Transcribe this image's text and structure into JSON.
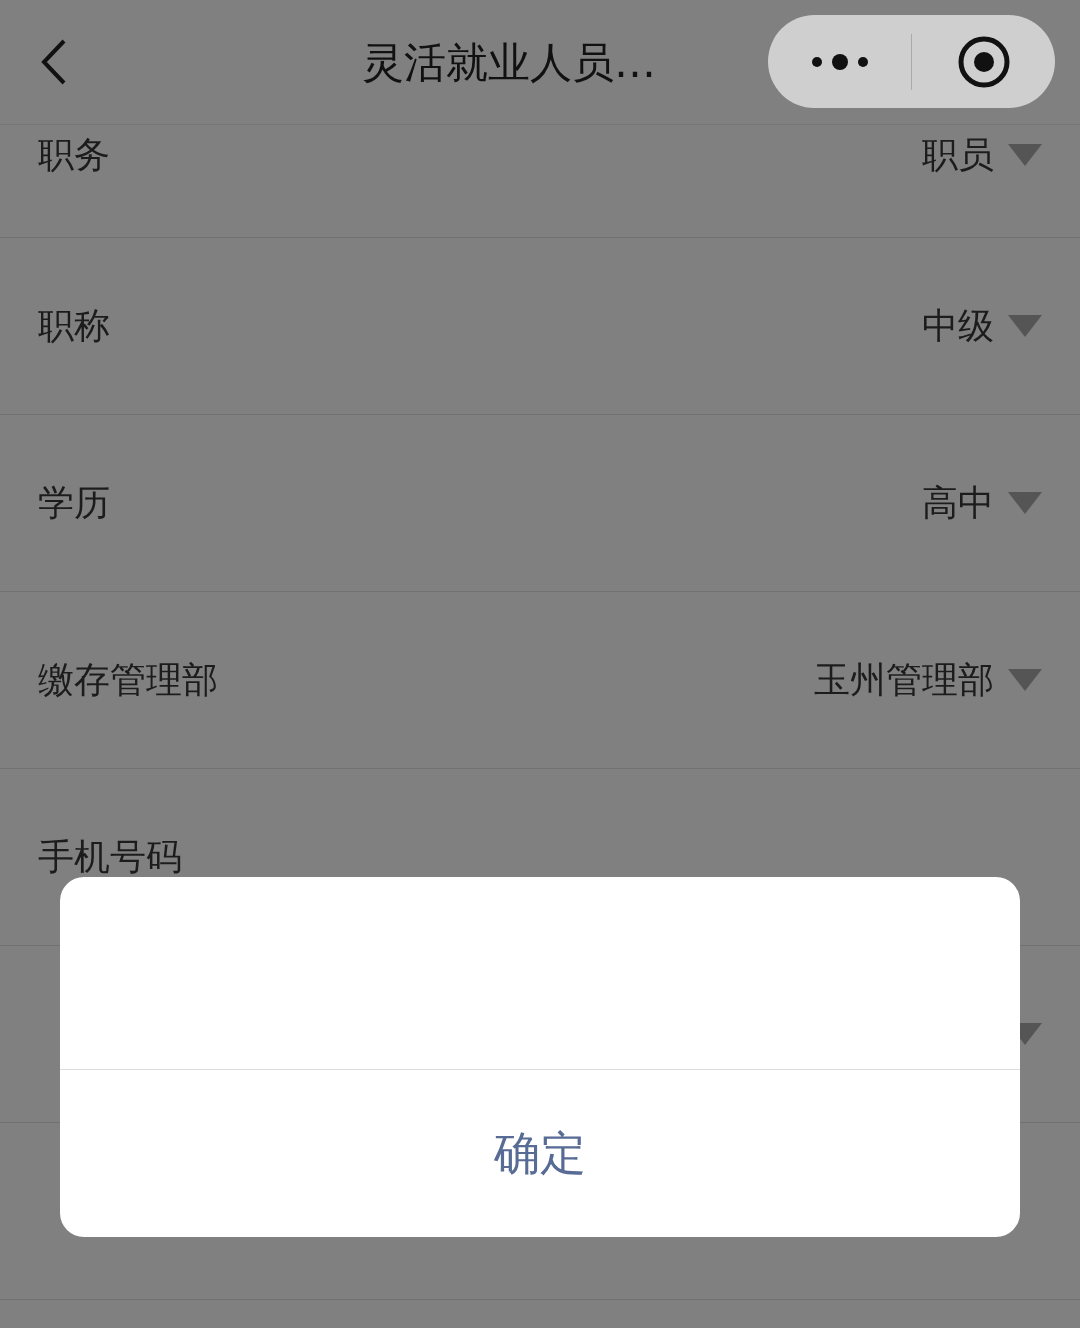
{
  "nav": {
    "title": "灵活就业人员…"
  },
  "form_rows": [
    {
      "label": "职务",
      "value": "职员",
      "kind": "select"
    },
    {
      "label": "职称",
      "value": "中级",
      "kind": "select"
    },
    {
      "label": "学历",
      "value": "高中",
      "kind": "select"
    },
    {
      "label": "缴存管理部",
      "value": "玉州管理部",
      "kind": "select"
    },
    {
      "label": "手机号码",
      "kind": "text"
    },
    {
      "kind": "select"
    },
    {
      "kind": "text"
    }
  ],
  "dialog": {
    "button": "确定"
  }
}
